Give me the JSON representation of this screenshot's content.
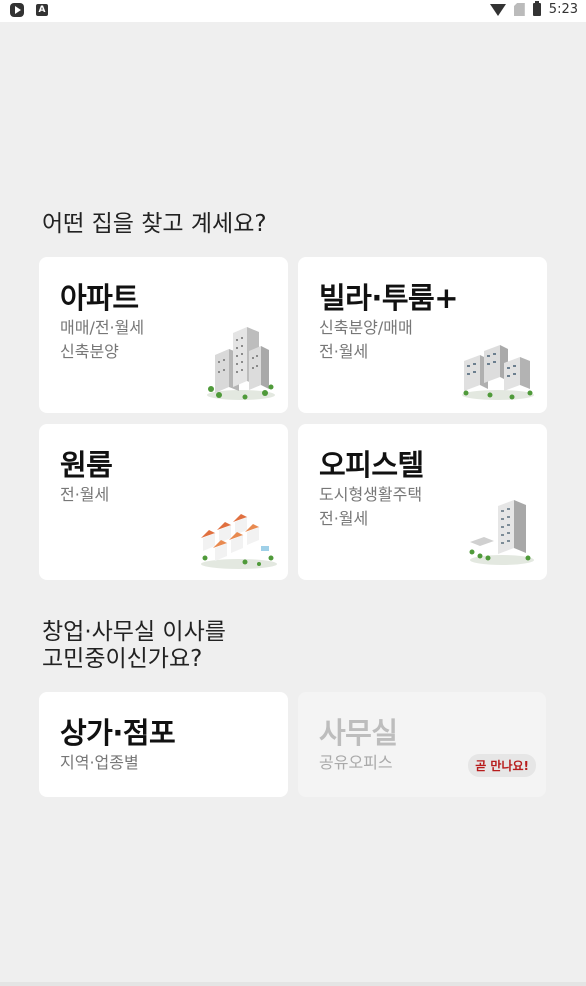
{
  "status_bar": {
    "time": "5:23"
  },
  "section1": {
    "heading": "어떤 집을 찾고 계세요?"
  },
  "section2": {
    "heading_line1": "창업·사무실 이사를",
    "heading_line2": "고민중이신가요?"
  },
  "cards": {
    "apartment": {
      "title": "아파트",
      "sub1": "매매/전·월세",
      "sub2": "신축분양",
      "icon": "apartment-building-icon"
    },
    "villa": {
      "title": "빌라·투룸+",
      "sub1": "신축분양/매매",
      "sub2": "전·월세",
      "icon": "villa-complex-icon"
    },
    "oneroom": {
      "title": "원룸",
      "sub1": "전·월세",
      "icon": "small-houses-icon"
    },
    "officetel": {
      "title": "오피스텔",
      "sub1": "도시형생활주택",
      "sub2": "전·월세",
      "icon": "officetel-tower-icon"
    },
    "store": {
      "title": "상가·점포",
      "sub1": "지역·업종별"
    },
    "office": {
      "title": "사무실",
      "sub1": "공유오피스",
      "badge": "곧 만나요!"
    }
  },
  "colors": {
    "background": "#efefef",
    "card": "#ffffff",
    "badge_text": "#b71c1c"
  }
}
